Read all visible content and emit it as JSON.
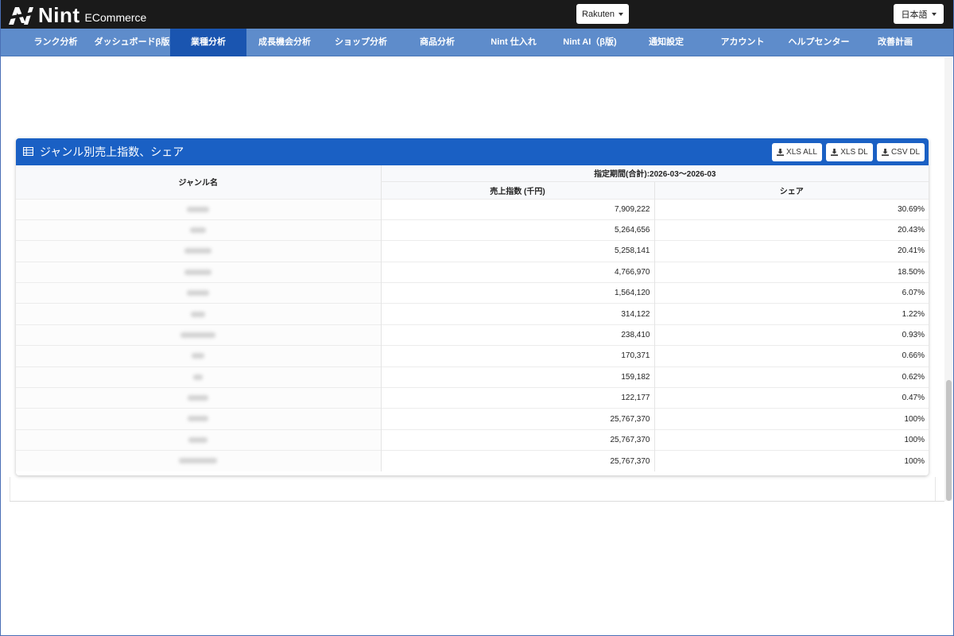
{
  "app": {
    "logo_text": "Nint",
    "logo_sub": "ECommerce",
    "marketplace_select": "Rakuten",
    "language_select": "日本語"
  },
  "nav": {
    "active_index": 2,
    "items": [
      "ランク分析",
      "ダッシュボードβ版",
      "業種分析",
      "成長機会分析",
      "ショップ分析",
      "商品分析",
      "Nint 仕入れ",
      "Nint AI（β版)",
      "通知設定",
      "アカウント",
      "ヘルプセンター",
      "改善計画"
    ]
  },
  "panel": {
    "title": "ジャンル別売上指数、シェア",
    "buttons": {
      "xls_all": "XLS ALL",
      "xls_dl": "XLS DL",
      "csv_dl": "CSV DL"
    },
    "table": {
      "col_name": "ジャンル名",
      "period_header": "指定期間(合計):2026-03〜2026-03",
      "col_sales": "売上指数 (千円)",
      "col_share": "シェア",
      "rows": [
        {
          "name": "",
          "sales": "7,909,222",
          "share": "30.69%"
        },
        {
          "name": "",
          "sales": "5,264,656",
          "share": "20.43%"
        },
        {
          "name": "",
          "sales": "5,258,141",
          "share": "20.41%"
        },
        {
          "name": "",
          "sales": "4,766,970",
          "share": "18.50%"
        },
        {
          "name": "",
          "sales": "1,564,120",
          "share": "6.07%"
        },
        {
          "name": "",
          "sales": "314,122",
          "share": "1.22%"
        },
        {
          "name": "",
          "sales": "238,410",
          "share": "0.93%"
        },
        {
          "name": "",
          "sales": "170,371",
          "share": "0.66%"
        },
        {
          "name": "",
          "sales": "159,182",
          "share": "0.62%"
        },
        {
          "name": "",
          "sales": "122,177",
          "share": "0.47%"
        },
        {
          "name": "",
          "sales": "25,767,370",
          "share": "100%"
        },
        {
          "name": "",
          "sales": "25,767,370",
          "share": "100%"
        },
        {
          "name": "",
          "sales": "25,767,370",
          "share": "100%"
        }
      ]
    }
  },
  "colors": {
    "nav_bg": "#5e8ccb",
    "nav_active": "#1a55b0",
    "panel_header": "#1a60c4",
    "topbar": "#1a1a1a"
  },
  "icons": {
    "logo": "nint-logo-icon",
    "panel": "table-icon",
    "download": "download-icon",
    "dropdown": "caret-down-icon"
  }
}
